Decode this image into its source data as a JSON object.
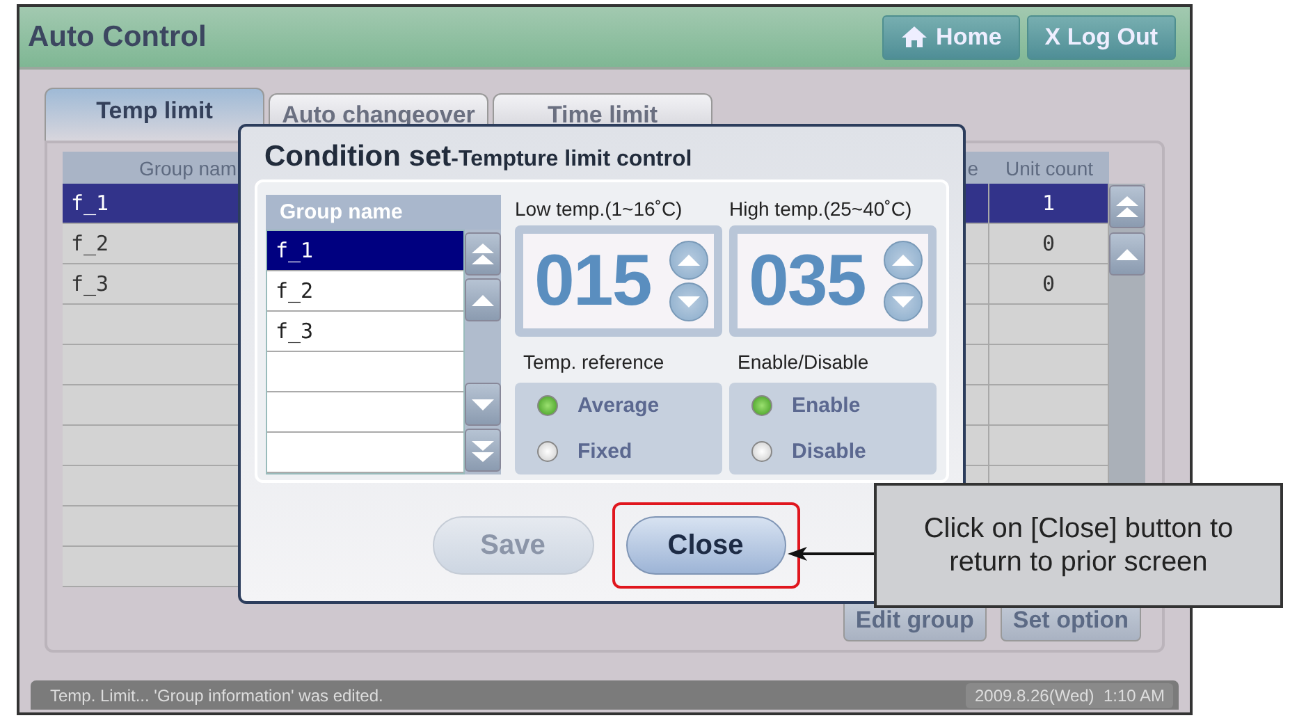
{
  "header": {
    "title": "Auto Control",
    "buttons": [
      {
        "kind": "home",
        "label": "Home"
      },
      {
        "kind": "logout",
        "label": "X Log Out"
      }
    ]
  },
  "tabs": [
    {
      "label": "Temp limit",
      "selected": true
    },
    {
      "label": "Auto changeover",
      "selected": false
    },
    {
      "label": "Time limit",
      "selected": false
    }
  ],
  "table": {
    "columns": [
      "Group nam",
      "e",
      "Unit count"
    ],
    "rows": [
      {
        "group": "f_1",
        "unit_count": "1",
        "selected": true
      },
      {
        "group": "f_2",
        "unit_count": "0",
        "selected": false
      },
      {
        "group": "f_3",
        "unit_count": "0",
        "selected": false
      }
    ]
  },
  "actions": [
    "Edit group",
    "Set option"
  ],
  "dialog": {
    "title": "Condition set",
    "subtitle": "-Tempture limit control",
    "group_list": {
      "header": "Group name",
      "items": [
        {
          "label": "f_1",
          "selected": true
        },
        {
          "label": "f_2",
          "selected": false
        },
        {
          "label": "f_3",
          "selected": false
        }
      ]
    },
    "temps": [
      {
        "label": "Low temp.(1~16˚C)",
        "value": "015"
      },
      {
        "label": "High temp.(25~40˚C)",
        "value": "035"
      }
    ],
    "radio_groups": [
      {
        "label": "Temp. reference",
        "options": [
          {
            "label": "Average",
            "selected": true
          },
          {
            "label": "Fixed",
            "selected": false
          }
        ]
      },
      {
        "label": "Enable/Disable",
        "options": [
          {
            "label": "Enable",
            "selected": true
          },
          {
            "label": "Disable",
            "selected": false
          }
        ]
      }
    ],
    "buttons": [
      {
        "label": "Save",
        "disabled": true,
        "highlighted": false
      },
      {
        "label": "Close",
        "disabled": false,
        "highlighted": true
      }
    ]
  },
  "callout": {
    "text": "Click on [Close] button to return to prior screen"
  },
  "status_bar": {
    "message": "Temp. Limit... 'Group information' was edited.",
    "datetime": "2009.8.26(Wed)  1:10 AM"
  }
}
